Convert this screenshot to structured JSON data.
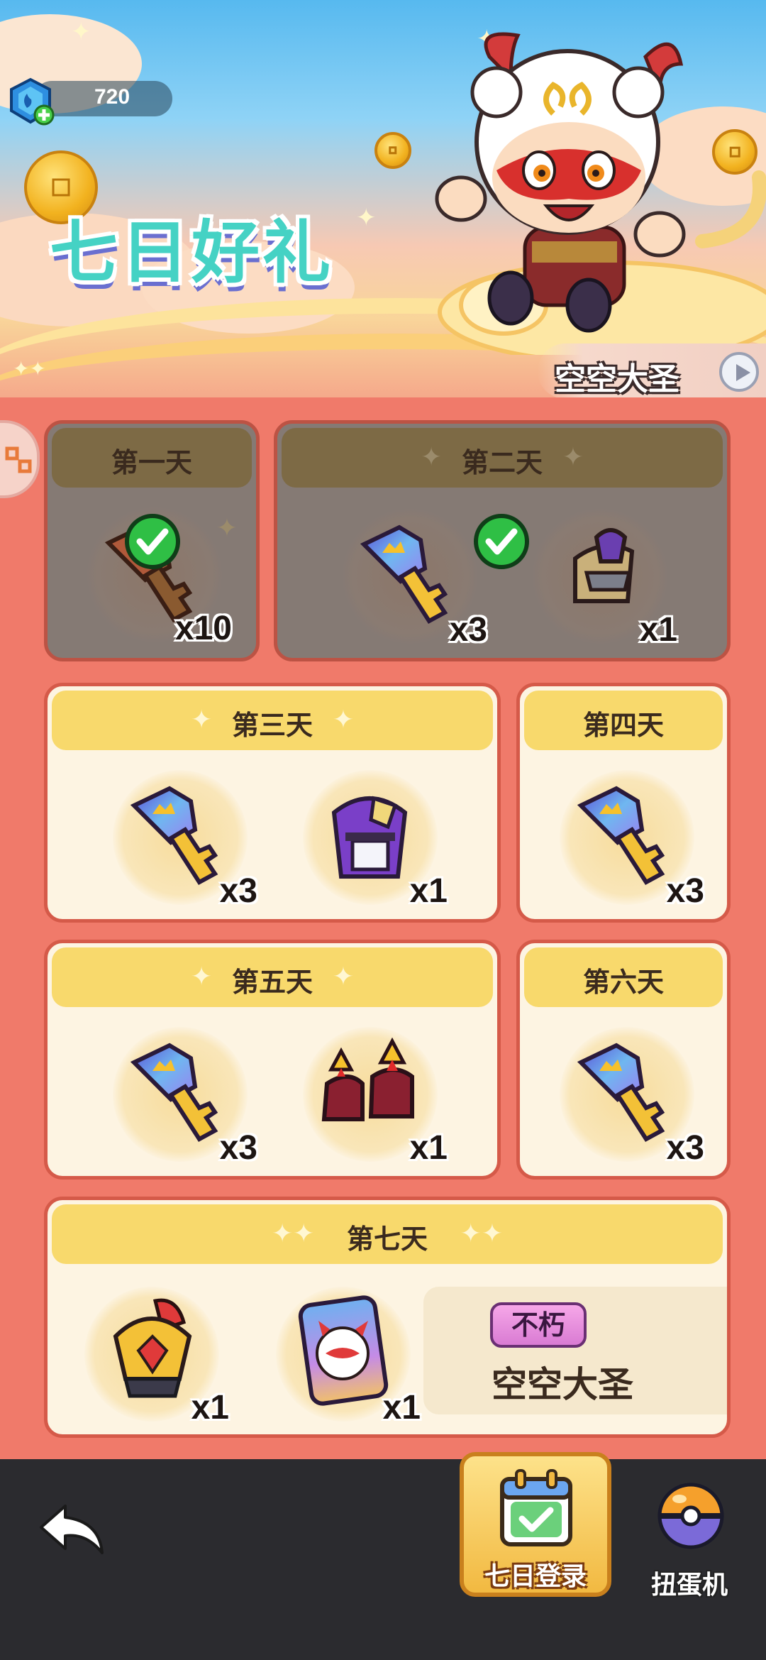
{
  "currency": {
    "amount": "720",
    "icon": "blue-gem-icon"
  },
  "header": {
    "title": "七日好礼",
    "hero_label": "空空大圣"
  },
  "days": [
    {
      "title": "第一天",
      "claimed": true,
      "items": [
        {
          "icon": "bronze-key-icon",
          "qty": "x10"
        }
      ]
    },
    {
      "title": "第二天",
      "claimed": true,
      "items": [
        {
          "icon": "rainbow-key-icon",
          "qty": "x3"
        },
        {
          "icon": "helmet-icon",
          "qty": "x1"
        }
      ]
    },
    {
      "title": "第三天",
      "claimed": false,
      "items": [
        {
          "icon": "rainbow-key-icon",
          "qty": "x3"
        },
        {
          "icon": "armor-icon",
          "qty": "x1"
        }
      ]
    },
    {
      "title": "第四天",
      "claimed": false,
      "items": [
        {
          "icon": "rainbow-key-icon",
          "qty": "x3"
        }
      ]
    },
    {
      "title": "第五天",
      "claimed": false,
      "items": [
        {
          "icon": "rainbow-key-icon",
          "qty": "x3"
        },
        {
          "icon": "boots-icon",
          "qty": "x1"
        }
      ]
    },
    {
      "title": "第六天",
      "claimed": false,
      "items": [
        {
          "icon": "rainbow-key-icon",
          "qty": "x3"
        }
      ]
    },
    {
      "title": "第七天",
      "claimed": false,
      "items": [
        {
          "icon": "golden-helmet-icon",
          "qty": "x1"
        },
        {
          "icon": "hero-card-icon",
          "qty": "x1"
        }
      ],
      "reward": {
        "rarity": "不朽",
        "name": "空空大圣"
      }
    }
  ],
  "bottom_nav": {
    "active_label": "七日登录",
    "gacha_label": "扭蛋机"
  },
  "colors": {
    "background": "#f07a6a",
    "card_border": "#d55a49",
    "card_header": "#f8d96c",
    "title_teal": "#45d2c4"
  }
}
